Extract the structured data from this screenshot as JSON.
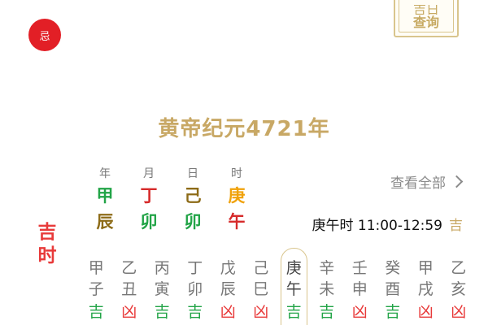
{
  "badge": {
    "label": "忌",
    "color": "#e21f26"
  },
  "query": {
    "line1": "吉日",
    "line2": "查询"
  },
  "era": "黄帝纪元4721年",
  "pillars": [
    {
      "label": "年",
      "stem": "甲",
      "branch": "辰",
      "stem_color": "#22a447",
      "branch_color": "#8d6b17"
    },
    {
      "label": "月",
      "stem": "丁",
      "branch": "卯",
      "stem_color": "#d62b2b",
      "branch_color": "#22a447"
    },
    {
      "label": "日",
      "stem": "己",
      "branch": "卯",
      "stem_color": "#8d6b17",
      "branch_color": "#22a447"
    },
    {
      "label": "时",
      "stem": "庚",
      "branch": "午",
      "stem_color": "#f0a20a",
      "branch_color": "#d62b2b"
    }
  ],
  "view_all": "查看全部",
  "day_luck": "吉时",
  "current_hour": {
    "name": "庚午时",
    "range": "11:00-12:59",
    "luck": "吉"
  },
  "hours": [
    {
      "stem": "甲",
      "branch": "子",
      "luck": "吉"
    },
    {
      "stem": "乙",
      "branch": "丑",
      "luck": "凶"
    },
    {
      "stem": "丙",
      "branch": "寅",
      "luck": "吉"
    },
    {
      "stem": "丁",
      "branch": "卯",
      "luck": "吉"
    },
    {
      "stem": "戊",
      "branch": "辰",
      "luck": "凶"
    },
    {
      "stem": "己",
      "branch": "巳",
      "luck": "凶"
    },
    {
      "stem": "庚",
      "branch": "午",
      "luck": "吉",
      "selected": true
    },
    {
      "stem": "辛",
      "branch": "未",
      "luck": "吉"
    },
    {
      "stem": "壬",
      "branch": "申",
      "luck": "凶"
    },
    {
      "stem": "癸",
      "branch": "酉",
      "luck": "吉"
    },
    {
      "stem": "甲",
      "branch": "戌",
      "luck": "凶"
    },
    {
      "stem": "乙",
      "branch": "亥",
      "luck": "凶"
    }
  ],
  "colors": {
    "gold": "#c8a865",
    "auspicious": "#22a447",
    "inauspicious": "#e83a3a",
    "day_luck": "#e83a3a"
  }
}
